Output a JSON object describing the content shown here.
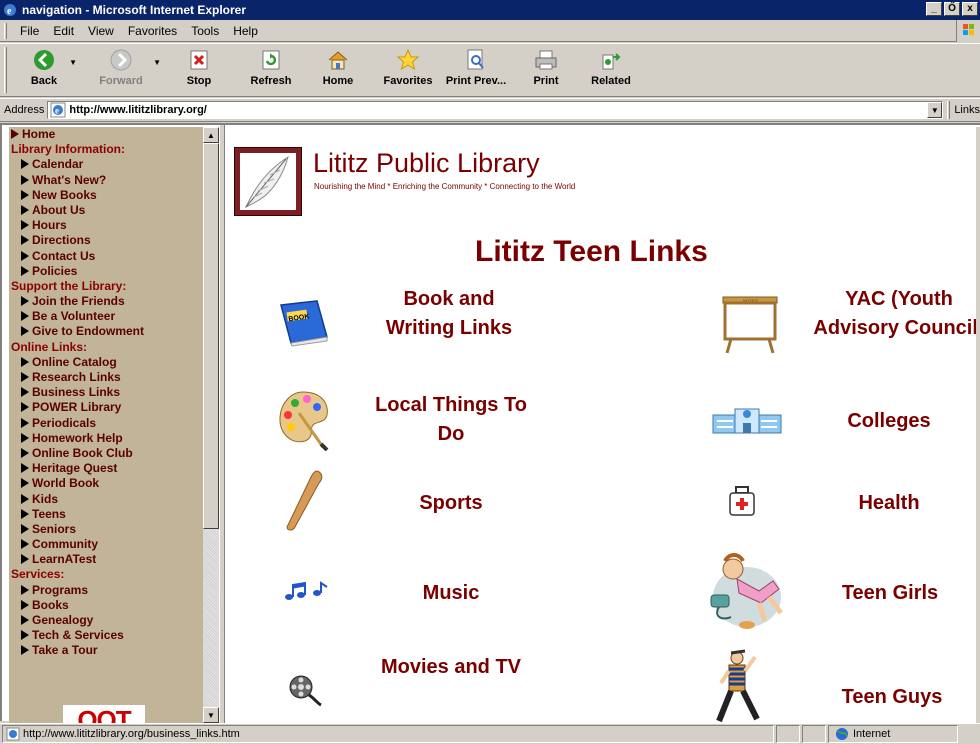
{
  "window": {
    "title": "navigation - Microsoft Internet Explorer",
    "controls": [
      "_",
      "Ő",
      "x"
    ]
  },
  "menu": [
    "File",
    "Edit",
    "View",
    "Favorites",
    "Tools",
    "Help"
  ],
  "toolbar": [
    {
      "label": "Back",
      "icon": "back-arrow-icon",
      "disabled": false,
      "dropdown": true
    },
    {
      "label": "Forward",
      "icon": "forward-arrow-icon",
      "disabled": true,
      "dropdown": true
    },
    {
      "label": "Stop",
      "icon": "stop-icon",
      "disabled": false,
      "dropdown": false
    },
    {
      "label": "Refresh",
      "icon": "refresh-icon",
      "disabled": false,
      "dropdown": false
    },
    {
      "label": "Home",
      "icon": "home-icon",
      "disabled": false,
      "dropdown": false
    },
    {
      "label": "Favorites",
      "icon": "star-icon",
      "disabled": false,
      "dropdown": false
    },
    {
      "label": "Print Prev...",
      "icon": "print-preview-icon",
      "disabled": false,
      "dropdown": false
    },
    {
      "label": "Print",
      "icon": "printer-icon",
      "disabled": false,
      "dropdown": false
    },
    {
      "label": "Related",
      "icon": "related-icon",
      "disabled": false,
      "dropdown": false
    }
  ],
  "address": {
    "label": "Address",
    "url": "http://www.lititzlibrary.org/",
    "links_label": "Links"
  },
  "nav": [
    {
      "label": "Home",
      "type": "top"
    },
    {
      "label": "Library Information:",
      "type": "section"
    },
    {
      "label": "Calendar",
      "type": "sub"
    },
    {
      "label": "What's New?",
      "type": "sub"
    },
    {
      "label": "New Books",
      "type": "sub"
    },
    {
      "label": "About Us",
      "type": "sub"
    },
    {
      "label": "Hours",
      "type": "sub"
    },
    {
      "label": "Directions",
      "type": "sub"
    },
    {
      "label": "Contact Us",
      "type": "sub"
    },
    {
      "label": "Policies",
      "type": "sub"
    },
    {
      "label": "Support the Library:",
      "type": "section"
    },
    {
      "label": "Join the Friends",
      "type": "sub"
    },
    {
      "label": "Be a Volunteer",
      "type": "sub"
    },
    {
      "label": "Give to Endowment",
      "type": "sub"
    },
    {
      "label": "Online Links:",
      "type": "section"
    },
    {
      "label": "Online Catalog",
      "type": "sub"
    },
    {
      "label": "Research Links",
      "type": "sub"
    },
    {
      "label": "Business Links",
      "type": "sub"
    },
    {
      "label": "POWER Library",
      "type": "sub"
    },
    {
      "label": "Periodicals",
      "type": "sub"
    },
    {
      "label": "Homework Help",
      "type": "sub"
    },
    {
      "label": "Online Book Club",
      "type": "sub"
    },
    {
      "label": "Heritage Quest",
      "type": "sub"
    },
    {
      "label": "World Book",
      "type": "sub"
    },
    {
      "label": "Kids",
      "type": "sub"
    },
    {
      "label": "Teens",
      "type": "sub"
    },
    {
      "label": "Seniors",
      "type": "sub"
    },
    {
      "label": "Community",
      "type": "sub"
    },
    {
      "label": "LearnATest",
      "type": "sub"
    },
    {
      "label": "Services:",
      "type": "section"
    },
    {
      "label": "Programs",
      "type": "sub"
    },
    {
      "label": "Books",
      "type": "sub"
    },
    {
      "label": "Genealogy",
      "type": "sub"
    },
    {
      "label": "Tech & Services",
      "type": "sub"
    },
    {
      "label": "Take a Tour",
      "type": "sub"
    }
  ],
  "page": {
    "library_name": "Lititz Public Library",
    "tagline": "Nourishing the Mind * Enriching the Community * Connecting to the World",
    "heading": "Lititz Teen Links"
  },
  "teen_links": {
    "book_writing": "Book and Writing Links",
    "yac": "YAC (Youth Advisory Council)",
    "local_things": "Local Things To Do",
    "colleges": "Colleges",
    "sports": "Sports",
    "health": "Health",
    "music": "Music",
    "teen_girls": "Teen Girls",
    "movies_tv": "Movies and TV",
    "teen_guys": "Teen Guys"
  },
  "clipart": {
    "book_label": "BOOK",
    "easel_label": "NOTICE",
    "partial_logo_text": "OOT"
  },
  "status": {
    "url": "http://www.lititzlibrary.org/business_links.htm",
    "zone": "Internet"
  },
  "colors": {
    "brand": "#7a0000",
    "nav_bg": "#c2b498",
    "title_bar": "#0a246a"
  }
}
